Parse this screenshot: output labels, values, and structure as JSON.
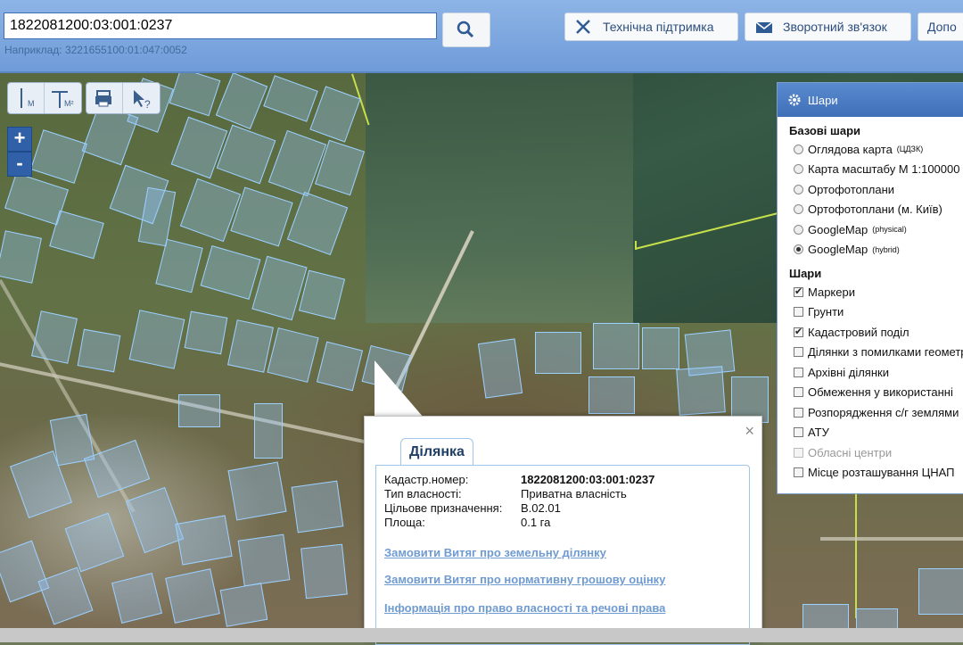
{
  "header": {
    "search_value": "1822081200:03:001:0237",
    "example": "Наприклад: 3221655100:01:047:0052",
    "buttons": [
      {
        "label": "Технічна підтримка",
        "icon": "tools-icon"
      },
      {
        "label": "Зворотний зв'язок",
        "icon": "envelope-icon"
      },
      {
        "label": "Допо",
        "icon": ""
      }
    ]
  },
  "map_tools": {
    "measure_m": "М",
    "measure_m2": "М²",
    "zoom_in": "+",
    "zoom_out": "-"
  },
  "layers_panel": {
    "title": "Шари",
    "base_title": "Базові шари",
    "base_layers": [
      {
        "label": "Оглядова карта",
        "sup": "(ЦДЗК)",
        "selected": false
      },
      {
        "label": "Карта масштабу М 1:100000",
        "sup": "",
        "selected": false
      },
      {
        "label": "Ортофотоплани",
        "sup": "",
        "selected": false
      },
      {
        "label": "Ортофотоплани (м. Київ)",
        "sup": "",
        "selected": false
      },
      {
        "label": "GoogleMap",
        "sup": "(physical)",
        "selected": false
      },
      {
        "label": "GoogleMap",
        "sup": "(hybrid)",
        "selected": true
      }
    ],
    "layers_title": "Шари",
    "layers": [
      {
        "label": "Маркери",
        "checked": true,
        "disabled": false
      },
      {
        "label": "Грунти",
        "checked": false,
        "disabled": false
      },
      {
        "label": "Кадастровий поділ",
        "checked": true,
        "disabled": false
      },
      {
        "label": "Ділянки з помилками геометрії",
        "checked": false,
        "disabled": false
      },
      {
        "label": "Архівні ділянки",
        "checked": false,
        "disabled": false
      },
      {
        "label": "Обмеження у використанні",
        "checked": false,
        "disabled": false
      },
      {
        "label": "Розпорядження с/г землями",
        "checked": false,
        "disabled": false
      },
      {
        "label": "АТУ",
        "checked": false,
        "disabled": false
      },
      {
        "label": "Обласні центри",
        "checked": false,
        "disabled": true
      },
      {
        "label": "Місце розташування ЦНАП",
        "checked": false,
        "disabled": false
      }
    ]
  },
  "popup": {
    "tab": "Ділянка",
    "close": "×",
    "fields": [
      {
        "label": "Кадастр.номер:",
        "value": "1822081200:03:001:0237",
        "bold": true
      },
      {
        "label": "Тип власності:",
        "value": "Приватна власність",
        "bold": false
      },
      {
        "label": "Цільове призначення:",
        "value": "В.02.01",
        "bold": false
      },
      {
        "label": "Площа:",
        "value": "0.1 га",
        "bold": false
      }
    ],
    "links": [
      "Замовити Витяг про земельну ділянку",
      "Замовити Витяг про нормативну грошову оцінку",
      "Інформація про право власності та речові права"
    ]
  },
  "colors": {
    "header_bg": "#7aa6e0",
    "parcel_fill": "#9cd0ff",
    "boundary": "#c7e04a",
    "link": "#6f9bd0"
  }
}
